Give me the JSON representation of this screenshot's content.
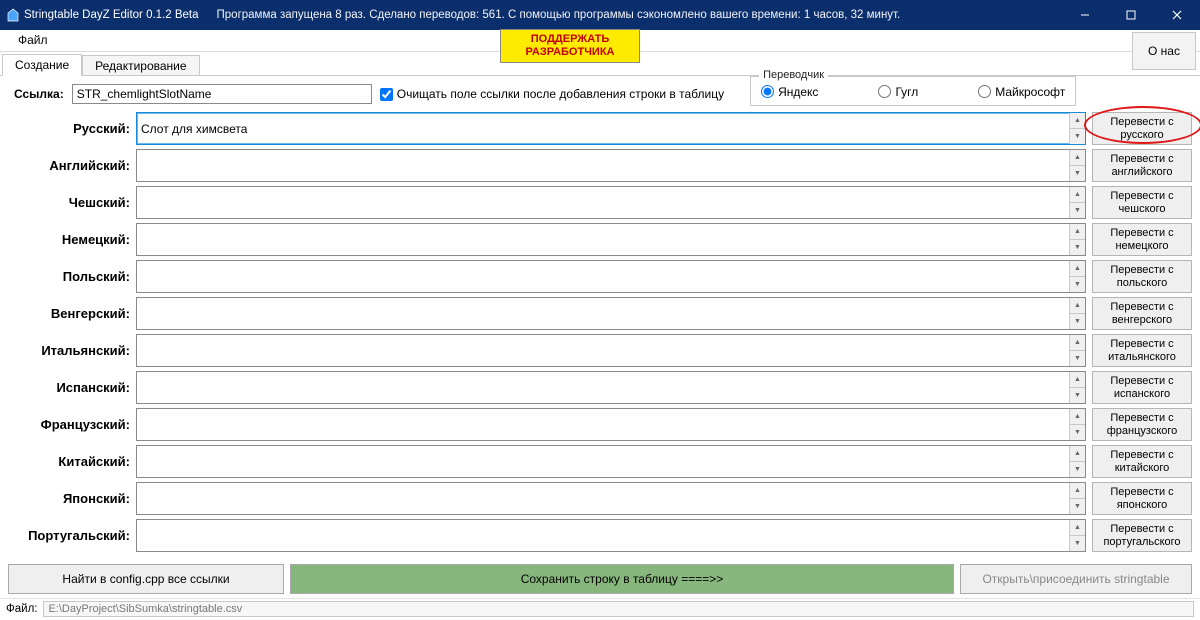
{
  "titlebar": {
    "app_title": "Stringtable DayZ Editor 0.1.2 Beta",
    "stats": "Программа запущена 8 раз. Сделано переводов: 561. С помощью программы сэкономлено вашего времени: 1 часов, 32 минут."
  },
  "menu": {
    "file": "Файл"
  },
  "about_btn": "О нас",
  "support_dev": "ПОДДЕРЖАТЬ РАЗРАБОТЧИКА",
  "tabs": {
    "create": "Создание",
    "edit": "Редактирование"
  },
  "link": {
    "label": "Ссылка:",
    "value": "STR_chemlightSlotName",
    "clear_checkbox": "Очищать поле ссылки после добавления строки в таблицу"
  },
  "translator": {
    "legend": "Переводчик",
    "yandex": "Яндекс",
    "google": "Гугл",
    "microsoft": "Майкрософт"
  },
  "langs": [
    {
      "label": "Русский:",
      "value": "Слот для химсвета",
      "btn": "Перевести с русского",
      "highlight": true
    },
    {
      "label": "Английский:",
      "value": "",
      "btn": "Перевести с английского"
    },
    {
      "label": "Чешский:",
      "value": "",
      "btn": "Перевести с чешского"
    },
    {
      "label": "Немецкий:",
      "value": "",
      "btn": "Перевести с немецкого"
    },
    {
      "label": "Польский:",
      "value": "",
      "btn": "Перевести с польского"
    },
    {
      "label": "Венгерский:",
      "value": "",
      "btn": "Перевести с венгерского"
    },
    {
      "label": "Итальянский:",
      "value": "",
      "btn": "Перевести с итальянского"
    },
    {
      "label": "Испанский:",
      "value": "",
      "btn": "Перевести с испанского"
    },
    {
      "label": "Французский:",
      "value": "",
      "btn": "Перевести с французского"
    },
    {
      "label": "Китайский:",
      "value": "",
      "btn": "Перевести с китайского"
    },
    {
      "label": "Японский:",
      "value": "",
      "btn": "Перевести с японского"
    },
    {
      "label": "Португальский:",
      "value": "",
      "btn": "Перевести с португальского"
    }
  ],
  "bottom": {
    "find": "Найти в config.cpp все ссылки",
    "save": "Сохранить строку в таблицу ====>>",
    "open": "Открыть\\присоединить stringtable"
  },
  "status": {
    "label": "Файл:",
    "path": "E:\\DayProject\\SibSumka\\stringtable.csv"
  }
}
